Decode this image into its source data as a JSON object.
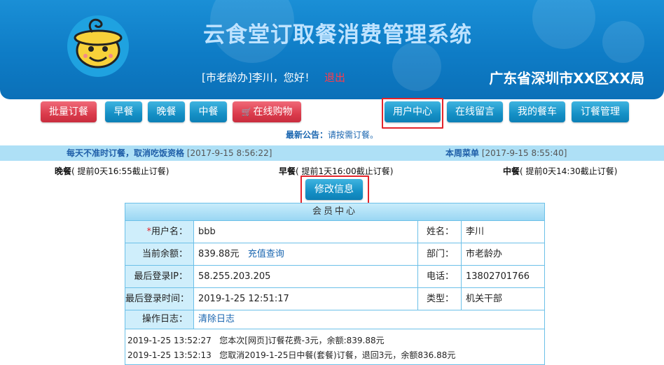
{
  "header": {
    "system_title": "云食堂订取餐消费管理系统",
    "welcome": "[市老龄办]李川，您好！",
    "logout": "退出",
    "org": "广东省深圳市XX区XX局"
  },
  "nav": {
    "left": [
      "批量订餐",
      "早餐",
      "晚餐",
      "中餐",
      "在线购物"
    ],
    "right": [
      "用户中心",
      "在线留言",
      "我的餐车",
      "订餐管理"
    ]
  },
  "notice": {
    "label": "最新公告：",
    "text": "请按需订餐。"
  },
  "info_bar": {
    "left_title": "每天不准时订餐，取消吃饭资格",
    "left_date": "[2017-9-15 8:56:22]",
    "right_title": "本周菜单",
    "right_date": "[2017-9-15 8:55:40]"
  },
  "deadlines": [
    {
      "meal": "晚餐",
      "text": "( 提前0天16:55截止订餐)"
    },
    {
      "meal": "早餐",
      "text": "( 提前1天16:00截止订餐)"
    },
    {
      "meal": "中餐",
      "text": "( 提前0天14:30截止订餐)"
    }
  ],
  "edit_button": "修改信息",
  "member_table": {
    "title": "会员中心",
    "rows": [
      {
        "label_req": "*",
        "label": "用户名：",
        "value": "bbb",
        "label2": "姓名：",
        "value2": "李川"
      },
      {
        "label": "当前余额：",
        "value": "839.88元",
        "link": "充值查询",
        "label2": "部门：",
        "value2": "市老龄办"
      },
      {
        "label": "最后登录IP：",
        "value": "58.255.203.205",
        "label2": "电话：",
        "value2": "13802701766"
      },
      {
        "label": "最后登录时间：",
        "value": "2019-1-25 12:51:17",
        "label2": "类型：",
        "value2": "机关干部"
      },
      {
        "label": "操作日志：",
        "link": "清除日志"
      }
    ],
    "log": [
      {
        "time": "2019-1-25 13:52:27",
        "text": "您本次[网页]订餐花费-3元，余额:839.88元"
      },
      {
        "time": "2019-1-25 13:52:13",
        "text": "您取消2019-1-25日中餐(套餐)订餐，退回3元，余额836.88元"
      }
    ]
  },
  "colors": {
    "header_blue": "#0e7cc6",
    "button_blue": "#1590c6",
    "button_red": "#db3b4c",
    "highlight": "#e3242b"
  }
}
